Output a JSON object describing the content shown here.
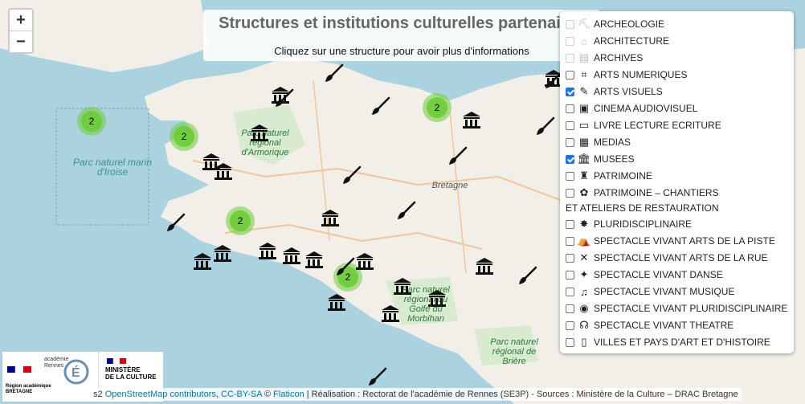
{
  "header": {
    "title": "Structures et institutions culturelles partenaires",
    "subtitle": "Cliquez sur une structure pour avoir plus d'informations"
  },
  "zoom": {
    "in": "+",
    "out": "−"
  },
  "map_labels": {
    "iroise": "Parc naturel marin d'Iroise",
    "armorique": "Parc naturel régional d'Armorique",
    "bretagne": "Bretagne",
    "morbihan": "Parc naturel régional du Golfe du Morbihan",
    "briere": "Parc naturel régional de Brière"
  },
  "layers": [
    {
      "label": "ARCHEOLOGIE",
      "checked": false,
      "faded": true,
      "icon": "archeology-icon"
    },
    {
      "label": "ARCHITECTURE",
      "checked": false,
      "faded": true,
      "icon": "architecture-icon"
    },
    {
      "label": "ARCHIVES",
      "checked": false,
      "faded": true,
      "icon": "archives-icon"
    },
    {
      "label": "ARTS NUMERIQUES",
      "checked": false,
      "faded": false,
      "icon": "digital-arts-icon"
    },
    {
      "label": "ARTS VISUELS",
      "checked": true,
      "faded": false,
      "icon": "brush-icon"
    },
    {
      "label": "CINEMA AUDIOVISUEL",
      "checked": false,
      "faded": false,
      "icon": "camera-icon"
    },
    {
      "label": "LIVRE LECTURE ECRITURE",
      "checked": false,
      "faded": false,
      "icon": "book-icon"
    },
    {
      "label": "MEDIAS",
      "checked": false,
      "faded": false,
      "icon": "newspaper-icon"
    },
    {
      "label": "MUSEES",
      "checked": true,
      "faded": false,
      "icon": "museum-icon"
    },
    {
      "label": "PATRIMOINE",
      "checked": false,
      "faded": false,
      "icon": "heritage-icon"
    },
    {
      "label": "PATRIMOINE – CHANTIERS",
      "checked": false,
      "faded": false,
      "icon": "worksite-icon"
    },
    {
      "label": "PLURIDISCIPLINAIRE",
      "checked": false,
      "faded": false,
      "icon": "multi-icon"
    },
    {
      "label": "SPECTACLE VIVANT ARTS DE LA PISTE",
      "checked": false,
      "faded": false,
      "icon": "circus-icon"
    },
    {
      "label": "SPECTACLE VIVANT ARTS DE LA RUE",
      "checked": false,
      "faded": false,
      "icon": "street-arts-icon"
    },
    {
      "label": "SPECTACLE VIVANT DANSE",
      "checked": false,
      "faded": false,
      "icon": "dance-icon"
    },
    {
      "label": "SPECTACLE VIVANT MUSIQUE",
      "checked": false,
      "faded": false,
      "icon": "music-icon"
    },
    {
      "label": "SPECTACLE VIVANT PLURIDISCIPLINAIRE",
      "checked": false,
      "faded": false,
      "icon": "multi-show-icon"
    },
    {
      "label": "SPECTACLE VIVANT THEATRE",
      "checked": false,
      "faded": false,
      "icon": "theatre-icon"
    },
    {
      "label": "VILLES ET PAYS D'ART ET D'HISTOIRE",
      "checked": false,
      "faded": false,
      "icon": "column-icon"
    }
  ],
  "layers_subline": "ET ATELIERS DE RESTAURATION",
  "clusters": [
    "2",
    "2",
    "2",
    "2",
    "2"
  ],
  "attribution": {
    "prefix": "s2",
    "osm": "OpenStreetMap contributors",
    "sep1": ", ",
    "license": "CC-BY-SA",
    "sep2": " © ",
    "flaticon": "Flaticon",
    "rest": " | Réalisation : Rectorat de l'académie de Rennes (SE3P) - Sources : Ministère de la Culture – DRAC Bretagne"
  },
  "logos": {
    "region_line1": "Région académique",
    "region_line2": "BRETAGNE",
    "academie": "académie",
    "rennes": "Rennes",
    "ministere1": "MINISTÈRE",
    "ministere2": "DE LA CULTURE"
  }
}
